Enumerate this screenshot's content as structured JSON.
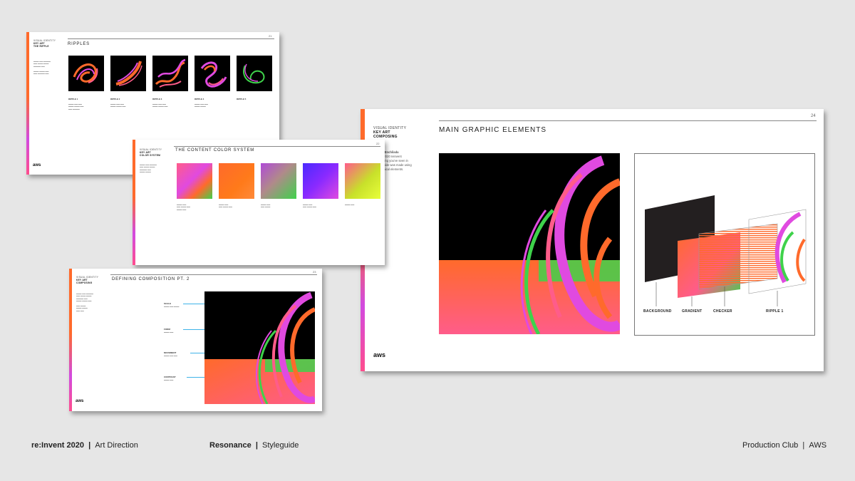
{
  "slide_ripples": {
    "sidebar": [
      "VISUAL IDENTITY",
      "KEY ART",
      "THE RIPPLE"
    ],
    "title": "RIPPLES",
    "page": "21",
    "items": [
      {
        "label": "RIPPLE 1"
      },
      {
        "label": "RIPPLE 2"
      },
      {
        "label": "RIPPLE 3"
      },
      {
        "label": "RIPPLE 4"
      },
      {
        "label": "RIPPLE 5"
      }
    ]
  },
  "slide_colors": {
    "sidebar": [
      "VISUAL IDENTITY",
      "KEY ART",
      "COLOR SYSTEM"
    ],
    "title": "THE CONTENT COLOR SYSTEM",
    "page": "22"
  },
  "slide_composition": {
    "sidebar": [
      "VISUAL IDENTITY",
      "KEY ART",
      "COMPOSING"
    ],
    "title": "DEFINING COMPOSITION PT. 2",
    "page": "23",
    "callouts": [
      "SCALE",
      "FORM",
      "MOVEMENT",
      "CONTRAST"
    ]
  },
  "slide_main": {
    "sidebar": [
      "VISUAL IDENTITY",
      "KEY ART",
      "COMPOSING"
    ],
    "title": "MAIN GRAPHIC ELEMENTS",
    "page": "24",
    "layers": [
      "BACKGROUND",
      "GRADIENT",
      "CHECKER",
      "RIPPLE 1"
    ],
    "body_fragments": [
      "o Enchilada",
      ", 2020 reinvent",
      "thing you've seen in",
      "guide was made using",
      "phical elements."
    ]
  },
  "aws_logo": "aws",
  "footer": {
    "left_bold": "re:Invent 2020",
    "left_sep": "|",
    "left_text": "Art Direction",
    "mid_bold": "Resonance",
    "mid_sep": "|",
    "mid_text": "Styleguide",
    "right_text": "Production Club",
    "right_sep": "|",
    "right_text2": "AWS"
  },
  "colors": {
    "orange": "#ff6a2b",
    "magenta": "#e04ae0",
    "pink": "#ff5c8a",
    "green": "#3fd24b",
    "black": "#000000"
  }
}
